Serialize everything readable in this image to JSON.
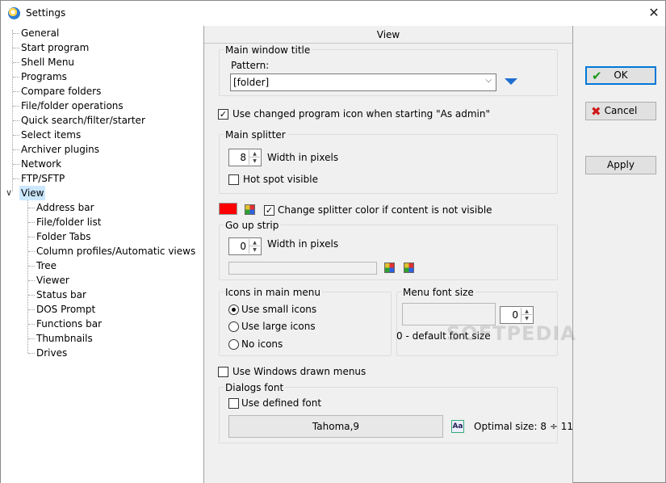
{
  "window": {
    "title": "Settings",
    "close_glyph": "✕"
  },
  "tree": {
    "items": [
      {
        "label": "General"
      },
      {
        "label": "Start program"
      },
      {
        "label": "Shell Menu"
      },
      {
        "label": "Programs"
      },
      {
        "label": "Compare folders"
      },
      {
        "label": "File/folder operations"
      },
      {
        "label": "Quick search/filter/starter"
      },
      {
        "label": "Select items"
      },
      {
        "label": "Archiver plugins"
      },
      {
        "label": "Network"
      },
      {
        "label": "FTP/SFTP"
      },
      {
        "label": "View"
      }
    ],
    "view_children": [
      {
        "label": "Address bar"
      },
      {
        "label": "File/folder list"
      },
      {
        "label": "Folder Tabs"
      },
      {
        "label": "Column profiles/Automatic views"
      },
      {
        "label": "Tree"
      },
      {
        "label": "Viewer"
      },
      {
        "label": "Status bar"
      },
      {
        "label": "DOS Prompt"
      },
      {
        "label": "Functions bar"
      },
      {
        "label": "Thumbnails"
      },
      {
        "label": "Drives"
      }
    ],
    "selected": "View"
  },
  "panel": {
    "header": "View",
    "main_window_title": {
      "group_label": "Main window title",
      "pattern_label": "Pattern:",
      "pattern_value": "[folder]"
    },
    "admin_icon": {
      "label": "Use changed program icon when starting \"As admin\"",
      "checked": true
    },
    "main_splitter": {
      "group_label": "Main splitter",
      "width_value": "8",
      "width_label": "Width in pixels",
      "hotspot_label": "Hot spot visible",
      "hotspot_checked": false
    },
    "splitter_color": {
      "color": "#ff0000",
      "label": "Change splitter color if content is not visible",
      "checked": true
    },
    "go_up_strip": {
      "group_label": "Go up strip",
      "width_value": "0",
      "width_label": "Width in pixels"
    },
    "icons_menu": {
      "group_label": "Icons in main menu",
      "options": [
        "Use small icons",
        "Use large icons",
        "No icons"
      ],
      "selected": "Use small icons"
    },
    "menu_font_size": {
      "group_label": "Menu font size",
      "value": "0",
      "note": "0 - default font size"
    },
    "windows_menus": {
      "label": "Use Windows drawn menus",
      "checked": false
    },
    "dialogs_font": {
      "group_label": "Dialogs font",
      "use_label": "Use defined font",
      "checked": false,
      "font_value": "Tahoma,9",
      "optimal_label": "Optimal size: 8 ÷ 11"
    }
  },
  "buttons": {
    "ok": "OK",
    "cancel": "Cancel",
    "apply": "Apply"
  },
  "colors": {
    "selection": "#cce8ff",
    "accent": "#0078d7",
    "ok_check": "#1a9a1a",
    "cancel_x": "#d01818"
  },
  "watermark": "SOFTPEDIA"
}
